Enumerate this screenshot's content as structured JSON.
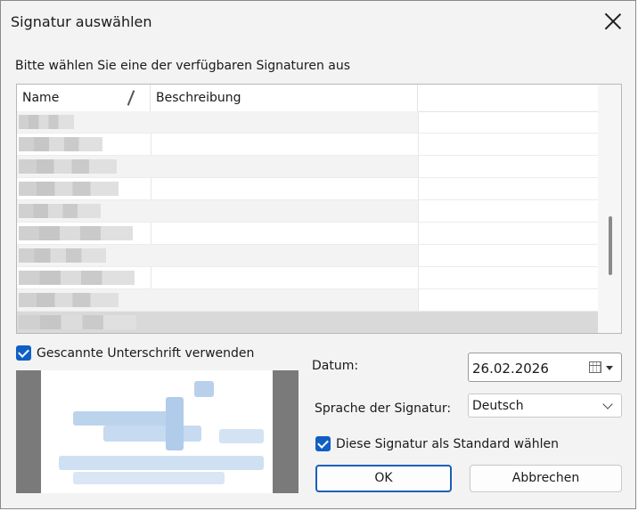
{
  "dialog": {
    "title": "Signatur auswählen",
    "prompt": "Bitte wählen Sie eine der verfügbaren Signaturen aus"
  },
  "list": {
    "columns": [
      "Name",
      "Beschreibung"
    ],
    "row_count": 10,
    "selected_row": 9
  },
  "scan_signature": {
    "label": "Gescannte Unterschrift verwenden",
    "checked": true
  },
  "date": {
    "label": "Datum:",
    "value": "26.02.2026"
  },
  "language": {
    "label": "Sprache der Signatur:",
    "value": "Deutsch"
  },
  "default_signature": {
    "label": "Diese Signatur als Standard wählen",
    "checked": true
  },
  "buttons": {
    "ok": "OK",
    "cancel": "Abbrechen"
  },
  "colors": {
    "accent": "#0f5fc4",
    "selected_row": "#d9d9d9",
    "preview_frame": "#7a7a7a"
  }
}
